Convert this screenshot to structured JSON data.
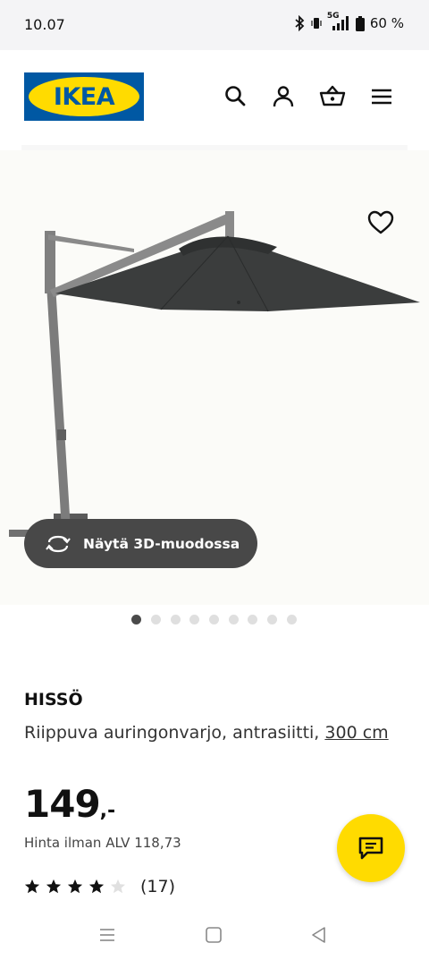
{
  "status_bar": {
    "time": "10.07",
    "network": "5G",
    "battery": "60 %"
  },
  "header": {
    "logo_text": "IKEA",
    "icons": [
      "search-icon",
      "account-icon",
      "cart-icon",
      "menu-icon"
    ]
  },
  "gallery": {
    "view_3d_label": "Näytä 3D-muodossa",
    "image_count": 9,
    "active_index": 0
  },
  "product": {
    "name": "HISSÖ",
    "description": "Riippuva auringonvarjo, antrasiitti,",
    "size": "300 cm",
    "price_integer": "149",
    "price_suffix": ",-",
    "price_vat": "Hinta ilman ALV 118,73",
    "rating": 4,
    "rating_max": 5,
    "review_count": "(17)"
  },
  "colors": {
    "brand_blue": "#0058a3",
    "brand_yellow": "#ffdb00",
    "umbrella_canopy": "#3b3d3d"
  }
}
